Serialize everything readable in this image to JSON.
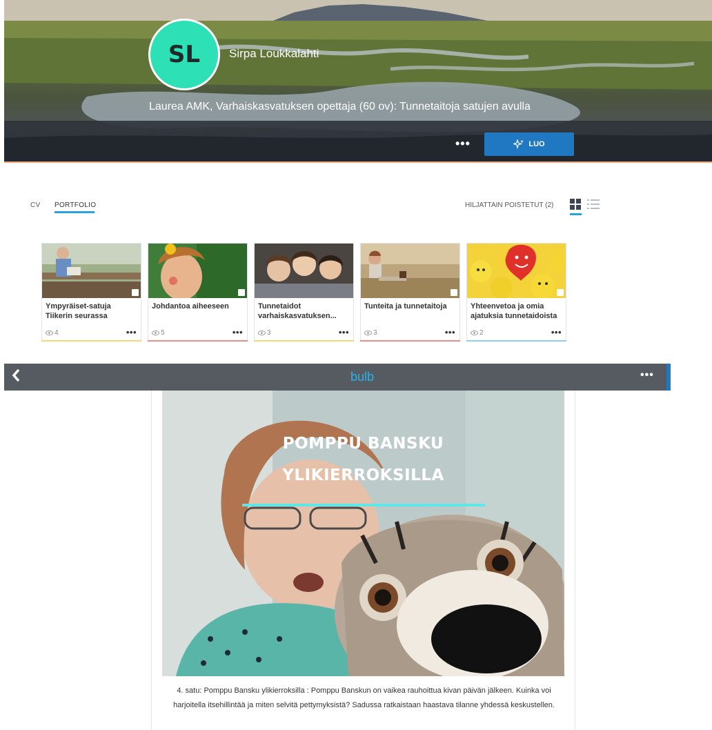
{
  "profile": {
    "initials": "SL",
    "name": "Sirpa Loukkalahti",
    "course": "Laurea AMK, Varhaiskasvatuksen opettaja (60 ov): Tunnetaitoja satujen avulla",
    "more_label": "•••",
    "create_label": "LUO",
    "avatar_color": "#2ee0b6",
    "create_color": "#1f78c1"
  },
  "tabs": {
    "cv": "CV",
    "portfolio": "PORTFOLIO",
    "active": "portfolio",
    "deleted_label": "HILJATTAIN POISTETUT (2)",
    "view_mode": "grid"
  },
  "cards": [
    {
      "title": "Ympyräiset-satuja Tiikerin seurassa",
      "views": "4",
      "more": "•••",
      "accent": "#f2d87a"
    },
    {
      "title": "Johdantoa aiheeseen",
      "views": "5",
      "more": "•••",
      "accent": "#ea8c8c"
    },
    {
      "title": "Tunnetaidot varhaiskasvatuksen...",
      "views": "3",
      "more": "•••",
      "accent": "#f2d87a"
    },
    {
      "title": "Tunteita ja tunnetaitoja",
      "views": "3",
      "more": "•••",
      "accent": "#ea8c8c"
    },
    {
      "title": "Yhteenvetoa ja omia ajatuksia tunnetaidoista",
      "views": "2",
      "more": "•••",
      "accent": "#8ed2ea"
    }
  ],
  "viewer": {
    "back_icon": "chevron-left-icon",
    "logo": "bulb",
    "more_label": "•••",
    "video_title_line1": "POMPPU BANSKU",
    "video_title_line2": "YLIKIERROKSILLA",
    "description": "4. satu: Pomppu Bansku ylikierroksilla : Pomppu Banskun on vaikea rauhoittua kivan päivän jälkeen. Kuinka voi harjoitella itsehillintää ja miten selvitä pettymyksistä? Sadussa ratkaistaan haastava tilanne yhdessä keskustellen."
  }
}
